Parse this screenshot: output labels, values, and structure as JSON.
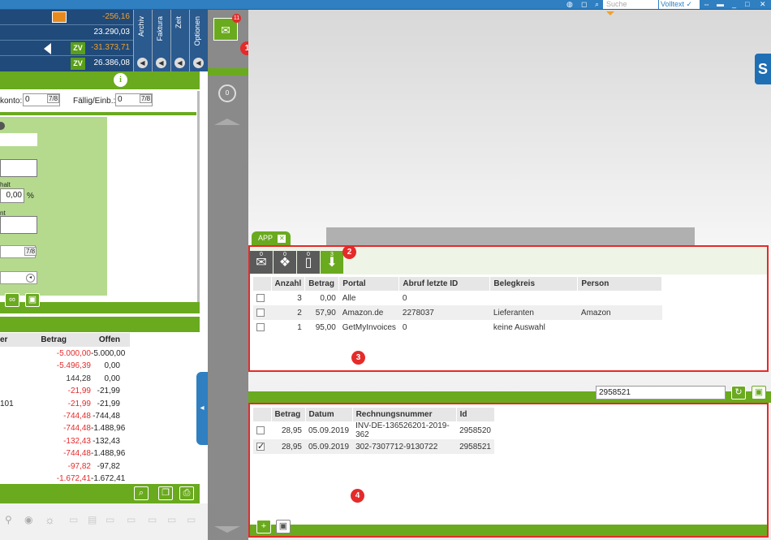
{
  "topbar": {
    "search_placeholder": "Suche",
    "volltext_label": "Volltext ✓"
  },
  "summary": {
    "rows": [
      {
        "value": "-256,16",
        "color": "#f0a030"
      },
      {
        "value": "23.290,03",
        "color": "#ffffff"
      },
      {
        "badge": "ZV",
        "value": "-31.373,71",
        "color": "#f0a030"
      },
      {
        "badge": "ZV",
        "value": "26.386,08",
        "color": "#ffffff"
      }
    ],
    "vtabs": [
      "Archiv",
      "Faktura",
      "Zeit",
      "Optionen"
    ]
  },
  "left_form": {
    "konto_label": "konto:",
    "konto_value": "0",
    "faellig_label": "Fällig/Einb.:",
    "faellig_value": "0",
    "ratio_btn": "7/8",
    "inhalt_label": "halt",
    "percent_value": "0,00",
    "percent_unit": "%",
    "ent_label": "nt"
  },
  "left_table": {
    "headers": [
      "er",
      "Betrag",
      "Offen"
    ],
    "rows": [
      {
        "c1": "",
        "betrag": "-5.000,00",
        "offen": "-5.000,00",
        "neg": true
      },
      {
        "c1": "",
        "betrag": "-5.496,39",
        "offen": "0,00",
        "neg": true
      },
      {
        "c1": "",
        "betrag": "144,28",
        "offen": "0,00",
        "neg": false
      },
      {
        "c1": "",
        "betrag": "-21,99",
        "offen": "-21,99",
        "neg": true
      },
      {
        "c1": "101",
        "betrag": "-21,99",
        "offen": "-21,99",
        "neg": true
      },
      {
        "c1": "",
        "betrag": "-744,48",
        "offen": "-744,48",
        "neg": true
      },
      {
        "c1": "",
        "betrag": "-744,48",
        "offen": "-1.488,96",
        "neg": true
      },
      {
        "c1": "",
        "betrag": "-132,43",
        "offen": "-132,43",
        "neg": true
      },
      {
        "c1": "",
        "betrag": "-744,48",
        "offen": "-1.488,96",
        "neg": true
      },
      {
        "c1": "",
        "betrag": "-97,82",
        "offen": "-97,82",
        "neg": true
      },
      {
        "c1": "",
        "betrag": "-1.672,41",
        "offen": "-1.672,41",
        "neg": true
      }
    ]
  },
  "midcol": {
    "badge_count": "11",
    "marker_1": "1",
    "circle_label": "0"
  },
  "app_tab": {
    "label": "APP"
  },
  "panel_portals": {
    "marker": "2",
    "marker_3": "3",
    "toolbar": [
      {
        "icon": "mail-icon",
        "count": "0",
        "glyph": "✉"
      },
      {
        "icon": "dropbox-icon",
        "count": "0",
        "glyph": "❖"
      },
      {
        "icon": "phone-icon",
        "count": "0",
        "glyph": "▯"
      },
      {
        "icon": "download-icon",
        "count": "3",
        "glyph": "⬇"
      }
    ],
    "headers": [
      "Anzahl",
      "Betrag",
      "Portal",
      "Abruf letzte ID",
      "Belegkreis",
      "Person"
    ],
    "rows": [
      {
        "anzahl": "3",
        "betrag": "0,00",
        "portal": "Alle",
        "abruf": "0",
        "belegkreis": "",
        "person": ""
      },
      {
        "anzahl": "2",
        "betrag": "57,90",
        "portal": "Amazon.de",
        "abruf": "2278037",
        "belegkreis": "Lieferanten",
        "person": "Amazon"
      },
      {
        "anzahl": "1",
        "betrag": "95,00",
        "portal": "GetMyInvoices",
        "abruf": "0",
        "belegkreis": "keine Auswahl",
        "person": ""
      }
    ]
  },
  "id_search": {
    "value": "2958521"
  },
  "panel_invoices": {
    "marker": "4",
    "headers": [
      "Betrag",
      "Datum",
      "Rechnungsnummer",
      "Id"
    ],
    "rows": [
      {
        "checked": false,
        "betrag": "28,95",
        "datum": "05.09.2019",
        "nummer": "INV-DE-136526201-2019-362",
        "id": "2958520"
      },
      {
        "checked": true,
        "betrag": "28,95",
        "datum": "05.09.2019",
        "nummer": "302-7307712-9130722",
        "id": "2958521"
      }
    ]
  }
}
